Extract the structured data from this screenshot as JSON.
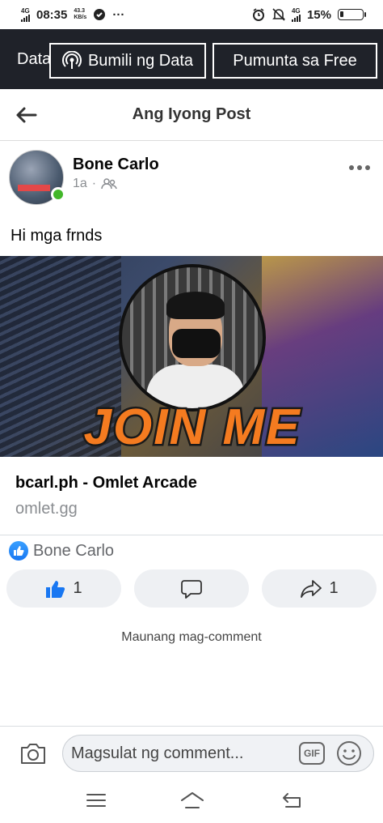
{
  "status_bar": {
    "network": "4G",
    "time": "08:35",
    "speed_value": "43.3",
    "speed_unit": "KB/s",
    "more": "···",
    "network_right": "4G",
    "battery": "15%",
    "battery_level": 0.15
  },
  "data_banner": {
    "partial_label": "Data",
    "buy_data_label": "Bumili ng Data",
    "go_free_label": "Pumunta sa Free"
  },
  "header": {
    "title": "Ang Iyong Post"
  },
  "post": {
    "author": "Bone Carlo",
    "time": "1a",
    "separator": "·",
    "text": "Hi mga frnds",
    "link": {
      "title": "bcarl.ph - Omlet Arcade",
      "domain": "omlet.gg",
      "image_text": "JOIN ME"
    },
    "reaction_name": "Bone Carlo",
    "actions": {
      "like_count": "1",
      "share_count": "1"
    },
    "first_comment_prompt": "Maunang mag-comment"
  },
  "comment_bar": {
    "placeholder": "Magsulat ng comment...",
    "gif_label": "GIF"
  },
  "colors": {
    "accent": "#1877f2",
    "banner_bg": "#1f2229",
    "online": "#42b72a"
  }
}
